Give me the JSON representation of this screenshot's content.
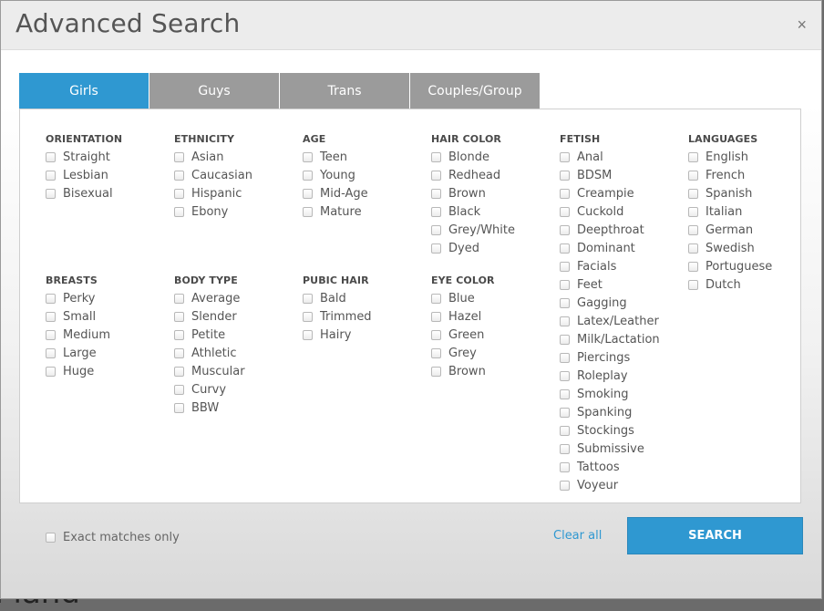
{
  "backdrop": {
    "peek_text": "Pland"
  },
  "modal": {
    "title": "Advanced Search",
    "close_label": "×"
  },
  "tabs": [
    {
      "label": "Girls",
      "active": true
    },
    {
      "label": "Guys",
      "active": false
    },
    {
      "label": "Trans",
      "active": false
    },
    {
      "label": "Couples/Group",
      "active": false
    }
  ],
  "groups": {
    "orientation": {
      "title": "ORIENTATION",
      "options": [
        "Straight",
        "Lesbian",
        "Bisexual"
      ]
    },
    "ethnicity": {
      "title": "ETHNICITY",
      "options": [
        "Asian",
        "Caucasian",
        "Hispanic",
        "Ebony"
      ]
    },
    "age": {
      "title": "AGE",
      "options": [
        "Teen",
        "Young",
        "Mid-Age",
        "Mature"
      ]
    },
    "hair_color": {
      "title": "HAIR COLOR",
      "options": [
        "Blonde",
        "Redhead",
        "Brown",
        "Black",
        "Grey/White",
        "Dyed"
      ]
    },
    "fetish": {
      "title": "FETISH",
      "options": [
        "Anal",
        "BDSM",
        "Creampie",
        "Cuckold",
        "Deepthroat",
        "Dominant",
        "Facials",
        "Feet",
        "Gagging",
        "Latex/Leather",
        "Milk/Lactation",
        "Piercings",
        "Roleplay",
        "Smoking",
        "Spanking",
        "Stockings",
        "Submissive",
        "Tattoos",
        "Voyeur"
      ]
    },
    "languages": {
      "title": "LANGUAGES",
      "options": [
        "English",
        "French",
        "Spanish",
        "Italian",
        "German",
        "Swedish",
        "Portuguese",
        "Dutch"
      ]
    },
    "breasts": {
      "title": "BREASTS",
      "options": [
        "Perky",
        "Small",
        "Medium",
        "Large",
        "Huge"
      ]
    },
    "body_type": {
      "title": "BODY TYPE",
      "options": [
        "Average",
        "Slender",
        "Petite",
        "Athletic",
        "Muscular",
        "Curvy",
        "BBW"
      ]
    },
    "pubic_hair": {
      "title": "PUBIC HAIR",
      "options": [
        "Bald",
        "Trimmed",
        "Hairy"
      ]
    },
    "eye_color": {
      "title": "EYE COLOR",
      "options": [
        "Blue",
        "Hazel",
        "Green",
        "Grey",
        "Brown"
      ]
    }
  },
  "footer": {
    "exact_label": "Exact matches only",
    "clear_label": "Clear all",
    "search_label": "SEARCH"
  },
  "colors": {
    "accent": "#2f98d1",
    "tab_inactive": "#9b9b9b"
  }
}
